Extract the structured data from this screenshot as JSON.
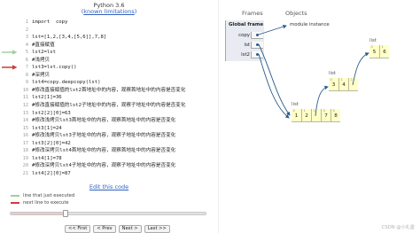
{
  "header": {
    "title": "Python 3.6",
    "limitations_link": "known limitations"
  },
  "code": {
    "lines": [
      {
        "num": "1",
        "text": "import  copy"
      },
      {
        "num": "2",
        "text": ""
      },
      {
        "num": "3",
        "text": "lst=[1,2,[3,4,[5,6]],7,8]"
      },
      {
        "num": "4",
        "text": "#直接赋值"
      },
      {
        "num": "5",
        "text": "lst2=lst"
      },
      {
        "num": "6",
        "text": "#浅拷贝"
      },
      {
        "num": "7",
        "text": "lst3=lst.copy()"
      },
      {
        "num": "8",
        "text": "#深拷贝"
      },
      {
        "num": "9",
        "text": "lst4=copy.deepcopy(lst)"
      },
      {
        "num": "10",
        "text": "#修改直接赋值的lst2首地址中的内容，观察首地址中的内容是否变化"
      },
      {
        "num": "11",
        "text": "lst2[1]=36"
      },
      {
        "num": "12",
        "text": "#修改直接赋值的lst2子地址中的内容，观察子地址中的内容是否变化"
      },
      {
        "num": "13",
        "text": "lst2[2][0]=63"
      },
      {
        "num": "14",
        "text": "#修改浅拷贝lst3首地址中的内容，观察首地址中的内容是否变化"
      },
      {
        "num": "15",
        "text": "lst3[1]=24"
      },
      {
        "num": "16",
        "text": "#修改浅拷贝lst3子地址中的内容，观察子地址中的内容是否变化"
      },
      {
        "num": "17",
        "text": "lst3[2][0]=42"
      },
      {
        "num": "18",
        "text": "#修改深拷贝lst4首地址中的内容，观察首地址中的内容是否变化"
      },
      {
        "num": "19",
        "text": "lst4[1]=78"
      },
      {
        "num": "20",
        "text": "#修改深拷贝lst4子地址中的内容，观察子地址中的内容是否变化"
      },
      {
        "num": "21",
        "text": "lst4[2][0]=87"
      }
    ],
    "just_executed_line": 5,
    "next_line": 7
  },
  "edit_link": "Edit this code",
  "legend": {
    "executed": "line that just executed",
    "next": "next line to execute"
  },
  "slider": {
    "position": 0.28
  },
  "buttons": {
    "first": "<< First",
    "prev": "< Prev",
    "next": "Next >",
    "last": "Last >>"
  },
  "viz": {
    "frames_label": "Frames",
    "objects_label": "Objects",
    "global_frame": "Global frame",
    "vars": [
      "copy",
      "lst",
      "lst2"
    ],
    "module_instance": "module instance",
    "list_label": "list",
    "outer_list": [
      "1",
      "2",
      "",
      "7",
      "8"
    ],
    "mid_list": [
      "3",
      "4",
      ""
    ],
    "inner_list": [
      "5",
      "6"
    ],
    "idx5": [
      "0",
      "1",
      "2",
      "3",
      "4"
    ],
    "idx3": [
      "0",
      "1",
      "2"
    ],
    "idx2": [
      "0",
      "1"
    ]
  },
  "watermark": "CSDN @小礼雷",
  "colors": {
    "executed_arrow": "#a0cfa0",
    "next_arrow": "#d13a3a",
    "pointer": "#2a5a8a",
    "list_cell": "#ffffc6",
    "frame_bg": "#e8ecf2"
  }
}
